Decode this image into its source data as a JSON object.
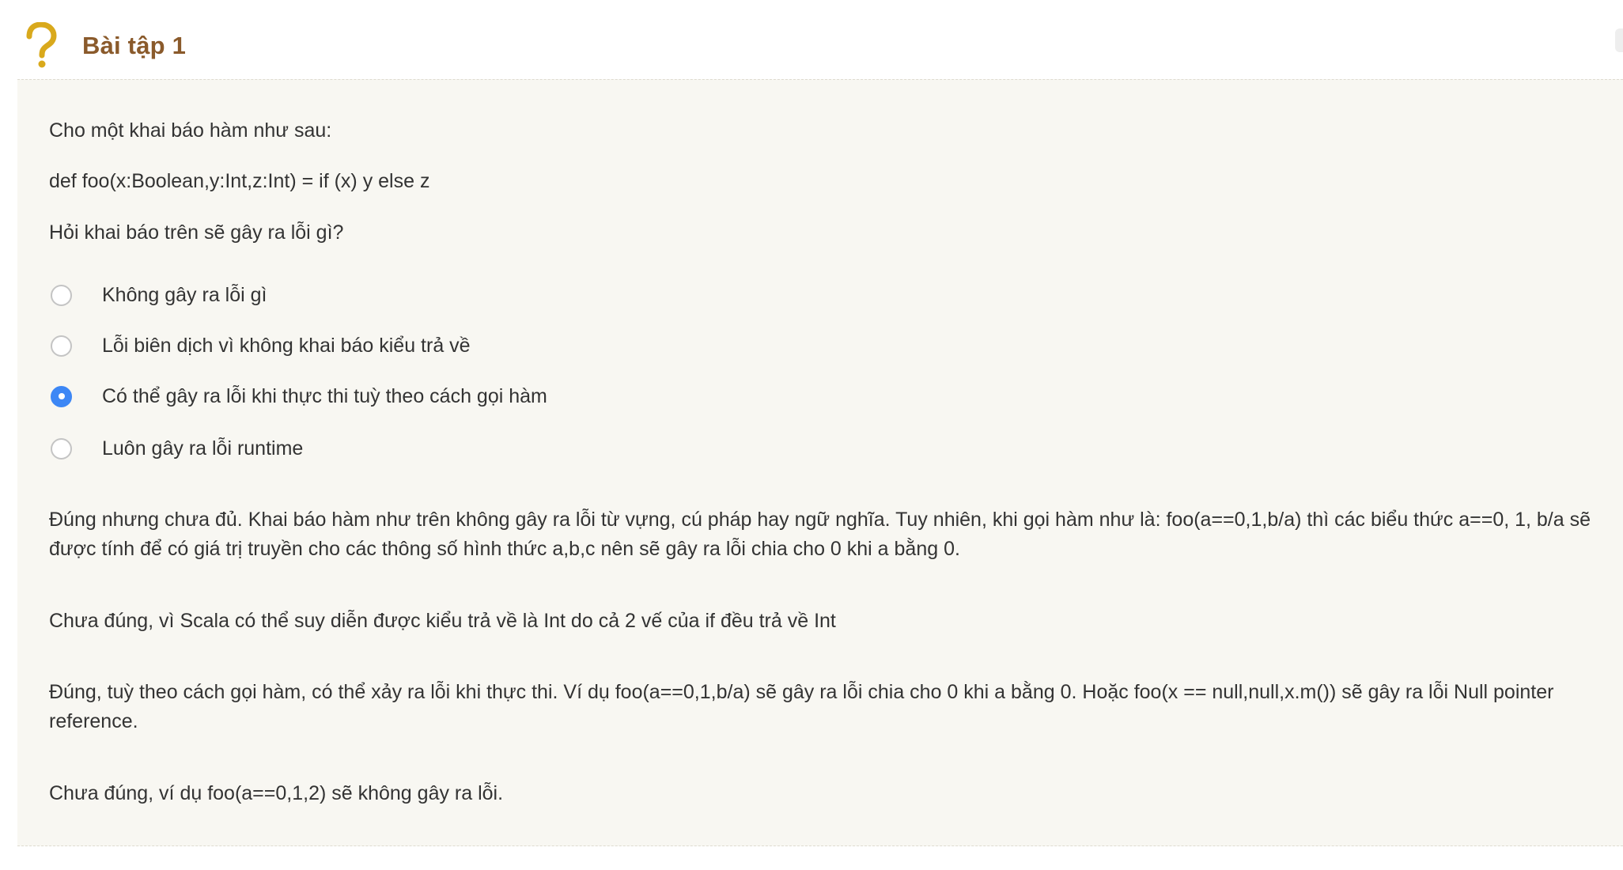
{
  "header": {
    "title": "Bài tập 1",
    "icon": "question-mark-icon",
    "icon_color": "#d9a91c",
    "title_color": "#8a5a2b"
  },
  "question": {
    "intro": "Cho một khai báo hàm như sau:",
    "code": "def foo(x:Boolean,y:Int,z:Int) = if (x) y else z",
    "prompt": "Hỏi khai báo trên sẽ gây ra lỗi gì?",
    "options": [
      {
        "label": "Không gây ra lỗi gì",
        "checked": false
      },
      {
        "label": "Lỗi biên dịch vì không khai báo kiểu trả về",
        "checked": false
      },
      {
        "label": "Có thể gây ra lỗi khi thực thi tuỳ theo cách gọi hàm",
        "checked": true
      },
      {
        "label": "Luôn gây ra lỗi runtime",
        "checked": false
      }
    ],
    "selected_color": "#3d87f5"
  },
  "feedback": [
    "Đúng nhưng chưa đủ. Khai báo hàm như trên không gây ra lỗi từ vựng, cú pháp hay ngữ nghĩa. Tuy nhiên, khi gọi hàm như là: foo(a==0,1,b/a) thì các biểu thức a==0, 1, b/a sẽ được tính để có giá trị truyền cho các thông số hình thức a,b,c nên sẽ gây ra lỗi chia cho 0 khi a bằng 0.",
    "Chưa đúng, vì Scala có thể suy diễn được kiểu trả về là Int do cả 2 vế của if đều trả về Int",
    "Đúng, tuỳ theo cách gọi hàm, có thể xảy ra lỗi khi thực thi. Ví dụ foo(a==0,1,b/a) sẽ gây ra lỗi chia cho 0 khi a bằng 0. Hoặc foo(x == null,null,x.m()) sẽ gây ra lỗi Null pointer reference.",
    "Chưa đúng, ví dụ foo(a==0,1,2) sẽ không gây ra lỗi."
  ]
}
